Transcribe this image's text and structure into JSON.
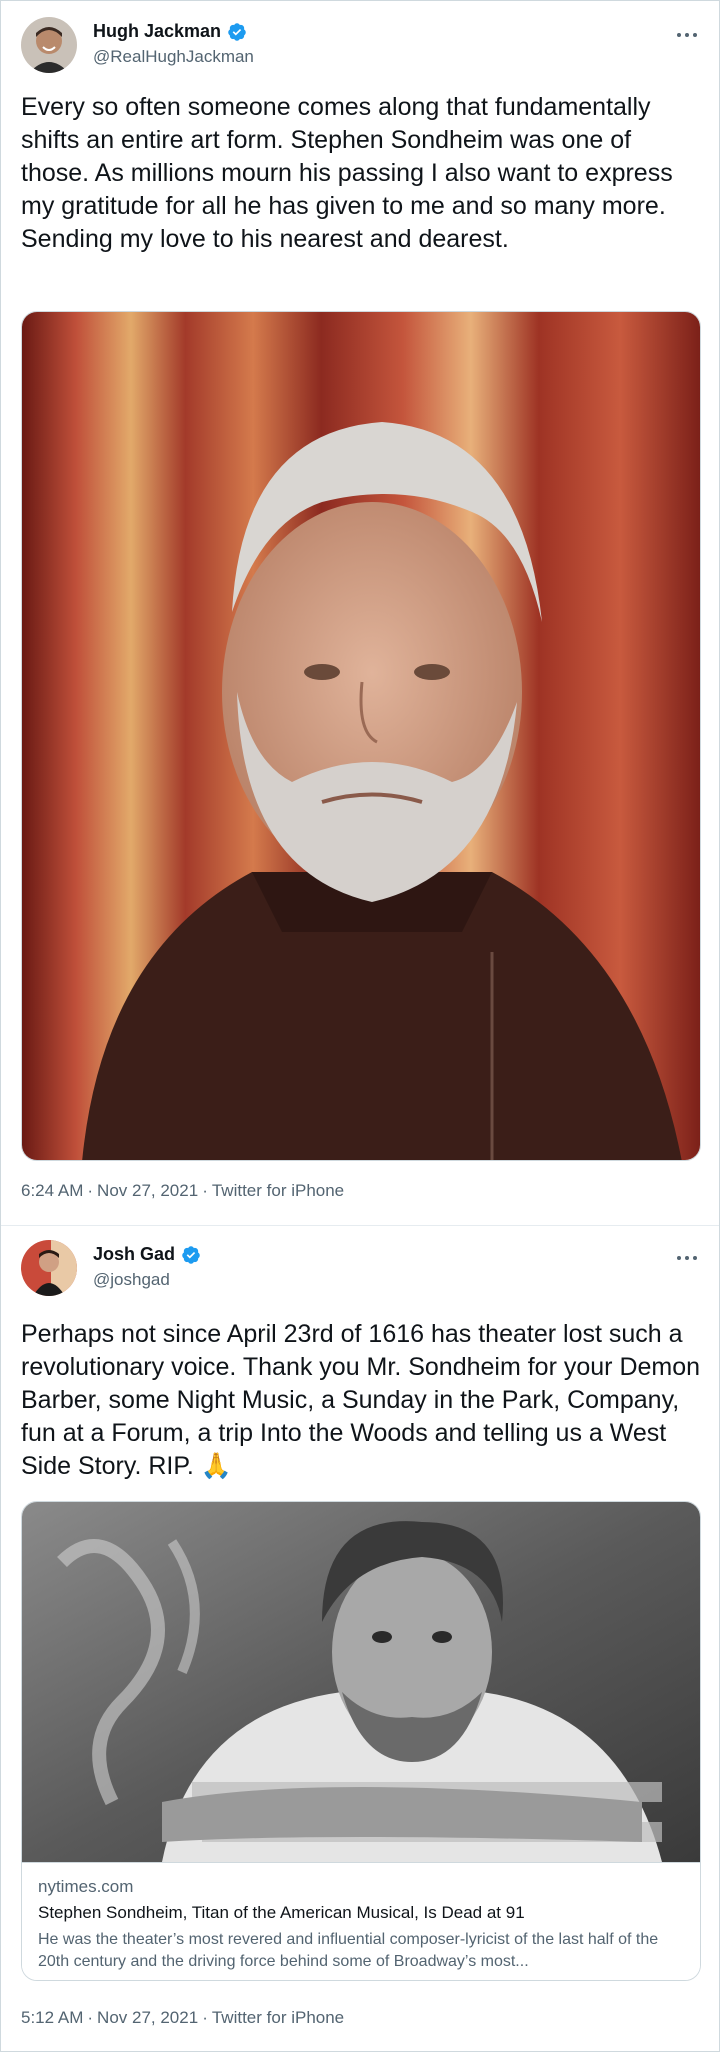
{
  "tweets": [
    {
      "author": {
        "name": "Hugh Jackman",
        "handle": "@RealHughJackman"
      },
      "text": "Every so often someone comes along that fundamentally shifts an entire art form. Stephen Sondheim was one of those. As millions mourn his passing I also want to express my gratitude for all he has given to me and so many more. Sending my love to his nearest and dearest.",
      "time": "6:24 AM",
      "date": "Nov 27, 2021",
      "source": "Twitter for iPhone"
    },
    {
      "author": {
        "name": "Josh Gad",
        "handle": "@joshgad"
      },
      "text": "Perhaps not since April 23rd of 1616 has theater lost such a revolutionary voice. Thank you Mr. Sondheim for your Demon Barber, some Night Music, a Sunday in the Park, Company, fun at a Forum, a trip Into the Woods and telling us a West Side Story. RIP. 🙏",
      "card": {
        "domain": "nytimes.com",
        "title": "Stephen Sondheim, Titan of the American Musical, Is Dead at 91",
        "description": "He was the theater’s most revered and influential composer-lyricist of the last half of the 20th century and the driving force behind some of Broadway’s most..."
      },
      "time": "5:12 AM",
      "date": "Nov 27, 2021",
      "source": "Twitter for iPhone"
    }
  ],
  "colors": {
    "accent": "#1d9bf0",
    "text": "#0f1419",
    "muted": "#536471",
    "border": "#cfd9de"
  },
  "icons": {
    "verified": "verified-badge-icon",
    "more": "more-horizontal-icon"
  }
}
